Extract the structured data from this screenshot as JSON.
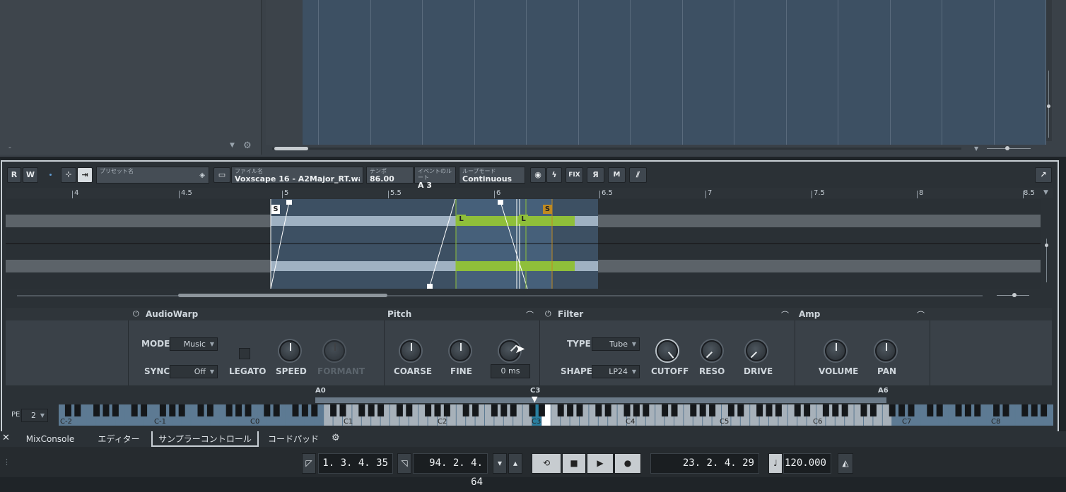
{
  "top": {
    "left_text": "-"
  },
  "toolbar": {
    "r_label": "R",
    "w_label": "W",
    "preset_label": "プリセット名",
    "preset_value": "",
    "file_label": "ファイル名",
    "file_value": "Voxscape 16 - A2Major_RT.wav",
    "tempo_label": "テンポ",
    "tempo_value": "86.00",
    "root_label": "イベントのルート",
    "root_value": "A 3",
    "loop_label": "ループモード",
    "loop_value": "Continuous",
    "fix_label": "FIX",
    "r_btn_label": "Я",
    "m_label": "M"
  },
  "ruler": {
    "ticks": [
      "4",
      "4.5",
      "5",
      "5.5",
      "6",
      "6.5",
      "7",
      "7.5",
      "8",
      "8.5"
    ]
  },
  "markers": {
    "s1": "S",
    "s2": "S",
    "l1": "L",
    "l2": "L"
  },
  "sections": {
    "audiowarp": {
      "title": "AudioWarp",
      "mode_label": "MODE",
      "mode_value": "Music",
      "sync_label": "SYNC",
      "sync_value": "Off",
      "legato_label": "LEGATO",
      "speed_label": "SPEED",
      "formant_label": "FORMANT"
    },
    "pitch": {
      "title": "Pitch",
      "coarse_label": "COARSE",
      "fine_label": "FINE",
      "ms_value": "0 ms"
    },
    "filter": {
      "title": "Filter",
      "type_label": "TYPE",
      "type_value": "Tube",
      "shape_label": "SHAPE",
      "shape_value": "LP24",
      "cutoff_label": "CUTOFF",
      "reso_label": "RESO",
      "drive_label": "DRIVE"
    },
    "amp": {
      "title": "Amp",
      "volume_label": "VOLUME",
      "pan_label": "PAN"
    }
  },
  "keyboard": {
    "pe_label": "PE",
    "pe_value": "2",
    "marker_a0": "A0",
    "marker_c3": "C3",
    "marker_a6": "A6",
    "octaves": [
      "C-2",
      "C-1",
      "C0",
      "C1",
      "C2",
      "C3",
      "C4",
      "C5",
      "C6",
      "C7",
      "C8"
    ]
  },
  "tabs": {
    "mixconsole": "MixConsole",
    "editor": "エディター",
    "sampler": "サンプラーコントロール",
    "chordpad": "コードパッド"
  },
  "transport": {
    "left_locator": "1. 3. 4. 35",
    "right_locator": "94. 2. 4. 64",
    "position": "23. 2. 4. 29",
    "tempo": "120.000"
  }
}
